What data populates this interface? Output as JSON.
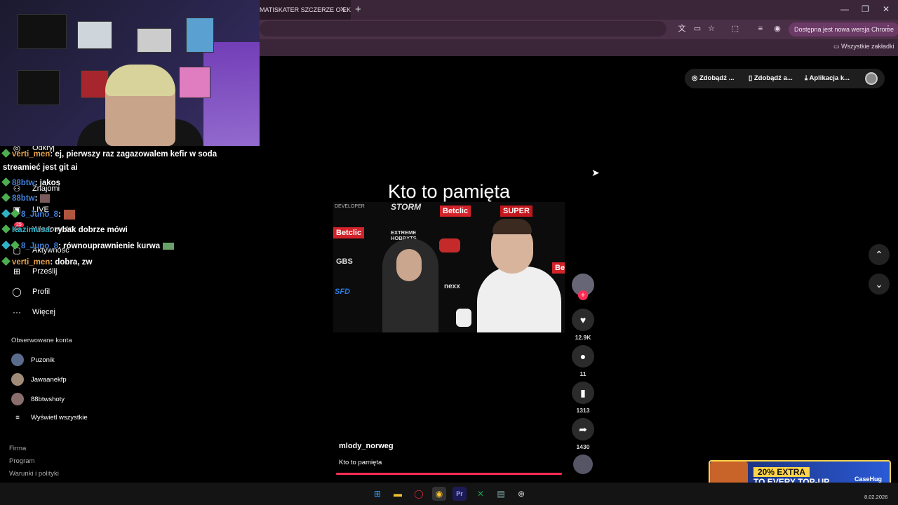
{
  "browser": {
    "tab_title": "MATISKATER SZCZERZE O EKIPIE",
    "tab_close": "✕",
    "new_tab": "+",
    "update_label": "Dostępna jest nowa wersja Chrome",
    "all_bookmarks": "Wszystkie zakładki",
    "win_min": "—",
    "win_max": "❐",
    "win_close": "✕"
  },
  "tiktok": {
    "top_actions": [
      "Zdobądź ...",
      "Zdobądź a...",
      "Aplikacja k..."
    ],
    "nav": [
      {
        "label": "Odkryj",
        "icon": "compass-icon"
      },
      {
        "label": "Znajomi",
        "icon": "users-icon"
      },
      {
        "label": "LIVE",
        "icon": "live-icon"
      },
      {
        "label": "Wiadomości",
        "icon": "message-icon",
        "badge": "25"
      },
      {
        "label": "Aktywność",
        "icon": "activity-icon"
      },
      {
        "label": "Prześlij",
        "icon": "upload-icon"
      },
      {
        "label": "Profil",
        "icon": "profile-icon"
      },
      {
        "label": "Więcej",
        "icon": "more-icon"
      }
    ],
    "followed_heading": "Obserwowane konta",
    "followed": [
      "Puzonik",
      "Jawaanekfp",
      "88btwshoty"
    ],
    "show_all": "Wyświetl wszystkie",
    "footer": [
      "Firma",
      "Program",
      "Warunki i polityki"
    ],
    "video": {
      "overlay_title": "Kto to pamięta",
      "author": "mlody_norweg",
      "caption": "Kto to pamięta",
      "likes": "12.9K",
      "comments": "11",
      "saves": "1313",
      "shares": "1430",
      "progress": 1.0
    }
  },
  "chat": [
    {
      "user": "verti_men",
      "color": "orange",
      "text": ": ej, pierwszy raz zagazowalem kefir w soda"
    },
    {
      "user": "",
      "color": "",
      "text": "streamieć jest git ai"
    },
    {
      "user": "88btw",
      "color": "blue",
      "text": ": jakos"
    },
    {
      "user": "88btw",
      "color": "blue",
      "text": ":"
    },
    {
      "user": "8_Juno_8",
      "color": "blue",
      "text": ":"
    },
    {
      "user": "Kazimusa",
      "color": "teal",
      "text": ": rybak dobrze mówi"
    },
    {
      "user": "8_Juno_8",
      "color": "blue",
      "text": ": równouprawnienie kurwa"
    },
    {
      "user": "verti_men",
      "color": "orange",
      "text": ": dobra, zw"
    }
  ],
  "sponsors": [
    "DEVELOPER",
    "STORM",
    "Betclic",
    "SUPER",
    "Betclic",
    "EXTREME HOBBYTS",
    "GBS",
    "nexx",
    "SFD",
    "Be"
  ],
  "ad": {
    "line1": "20% EXTRA",
    "line2": "TO EVERY TOP-UP",
    "brand": "CaseHug"
  },
  "taskbar": {
    "date": "8.02.2026"
  }
}
